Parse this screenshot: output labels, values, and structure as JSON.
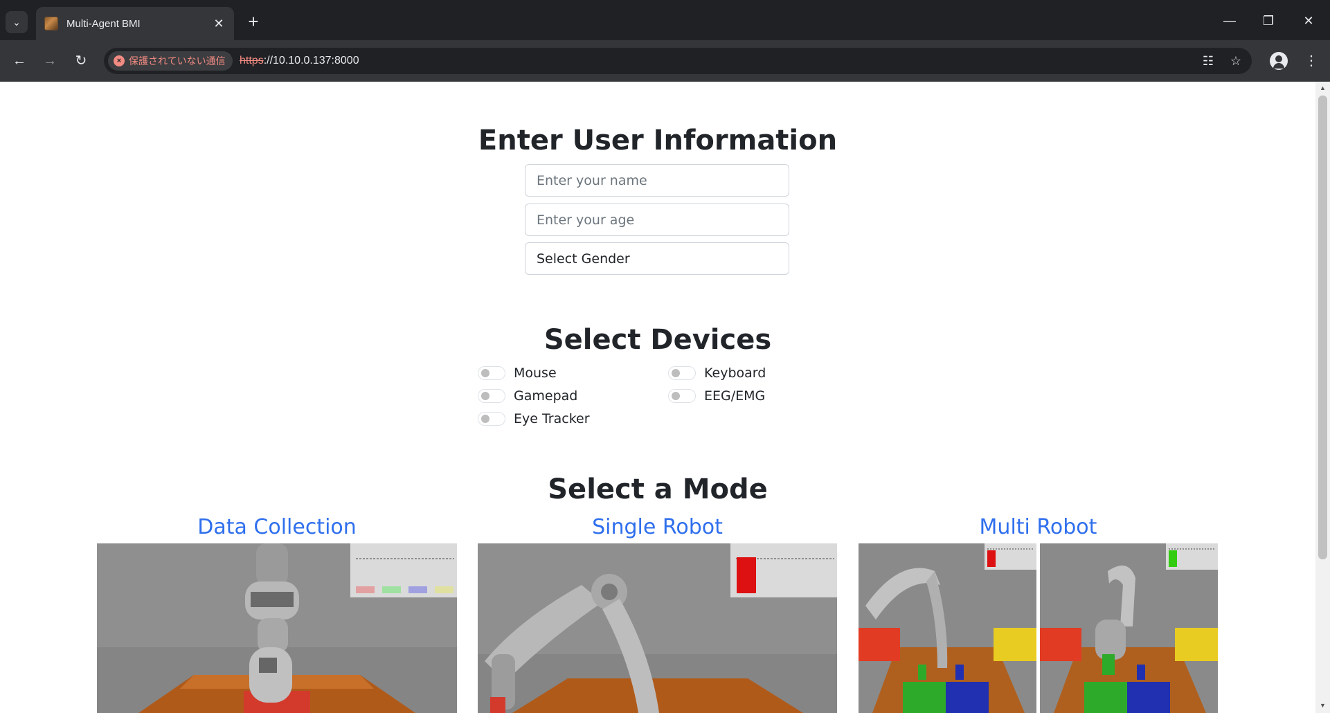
{
  "browser": {
    "tab_title": "Multi-Agent BMI",
    "security_label": "保護されていない通信",
    "url_scheme": "https",
    "url_rest": "://10.10.0.137:8000"
  },
  "user_info": {
    "heading": "Enter User Information",
    "name_placeholder": "Enter your name",
    "age_placeholder": "Enter your age",
    "gender_selected": "Select Gender"
  },
  "devices": {
    "heading": "Select Devices",
    "items": [
      {
        "label": "Mouse",
        "enabled": false
      },
      {
        "label": "Keyboard",
        "enabled": false
      },
      {
        "label": "Gamepad",
        "enabled": false
      },
      {
        "label": "EEG/EMG",
        "enabled": false
      },
      {
        "label": "Eye Tracker",
        "enabled": false
      }
    ]
  },
  "modes": {
    "heading": "Select a Mode",
    "items": [
      {
        "label": "Data Collection"
      },
      {
        "label": "Single Robot"
      },
      {
        "label": "Multi Robot"
      }
    ]
  },
  "colors": {
    "chrome_dark": "#202124",
    "chrome_toolbar": "#35363a",
    "link_blue": "#2f6fed",
    "insecure_red": "#f28b82"
  }
}
